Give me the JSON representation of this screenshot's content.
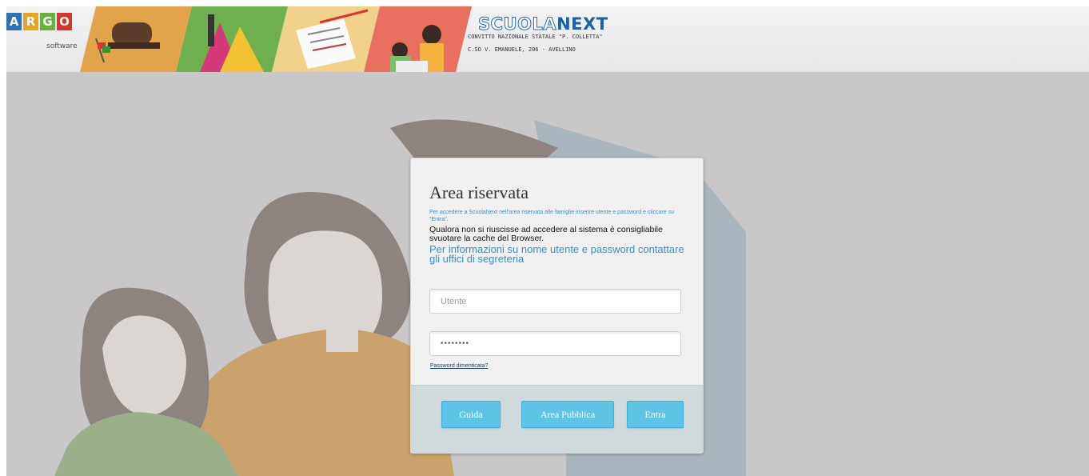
{
  "header": {
    "argo_letters": [
      "A",
      "R",
      "G",
      "O"
    ],
    "argo_letter_colors": [
      "#2f6fb4",
      "#e9a321",
      "#66b342",
      "#d8352a"
    ],
    "argo_sub": "software",
    "scuolanext_a": "SCUOLA",
    "scuolanext_b": "NEXT",
    "school_name": "CONVITTO NAZIONALE STATALE \"P. COLLETTA\"",
    "school_address": "C.SO V. EMANUELE, 206 - AVELLINO"
  },
  "login": {
    "title": "Area riservata",
    "info_small": "Per accedere a ScuolaNext nell'area riservata alle famiglie inserire utente e password e cliccare su \"Entra\".",
    "info_black": "Qualora non si riuscisse ad accedere al sistema è consigliabile svuotare la cache del Browser.",
    "info_link": "Per informazioni su nome utente e password contattare gli uffici di segreteria",
    "username_placeholder": "Utente",
    "password_value": "••••••••",
    "forgot_password": "Password dimenticata?",
    "buttons": {
      "guida": "Guida",
      "area_pubblica": "Area Pubblica",
      "entra": "Entra"
    }
  },
  "colors": {
    "accent_button": "#5ec4e6",
    "link": "#3b8fc4",
    "stage_background": "#c9c7c7"
  }
}
